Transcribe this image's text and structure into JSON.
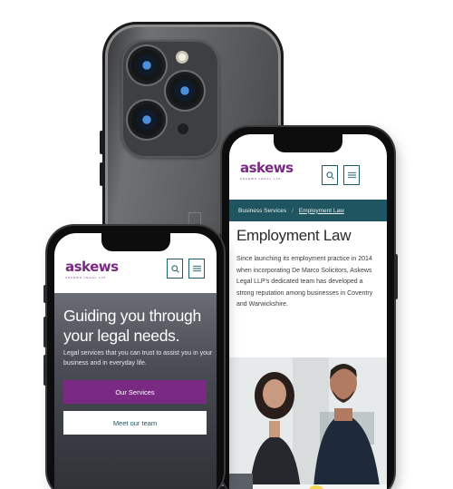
{
  "right_phone": {
    "logo": {
      "word": "askews",
      "tagline": "ASKEWS LEGAL LLP"
    },
    "breadcrumb": {
      "parent": "Business Services",
      "separator": "/",
      "current": "Employment Law"
    },
    "heading": "Employment Law",
    "intro": "Since launching its employment practice in 2014 when incorporating De Marco Solicitors, Askews Legal LLP's dedicated team has developed a strong reputation among businesses in Coventry and Warwickshire."
  },
  "left_phone": {
    "logo": {
      "word": "askews",
      "tagline": "ASKEWS LEGAL LLP"
    },
    "hero": {
      "heading": "Guiding you through your legal needs.",
      "text": "Legal services that you can trust to assist you in your business and in everyday life.",
      "primary_button": "Our Services",
      "secondary_button": "Meet our team"
    }
  },
  "colors": {
    "brand_purple": "#7a2a83",
    "brand_teal": "#1f5560"
  },
  "icons": [
    "search-icon",
    "menu-icon",
    "apple-logo-icon"
  ]
}
